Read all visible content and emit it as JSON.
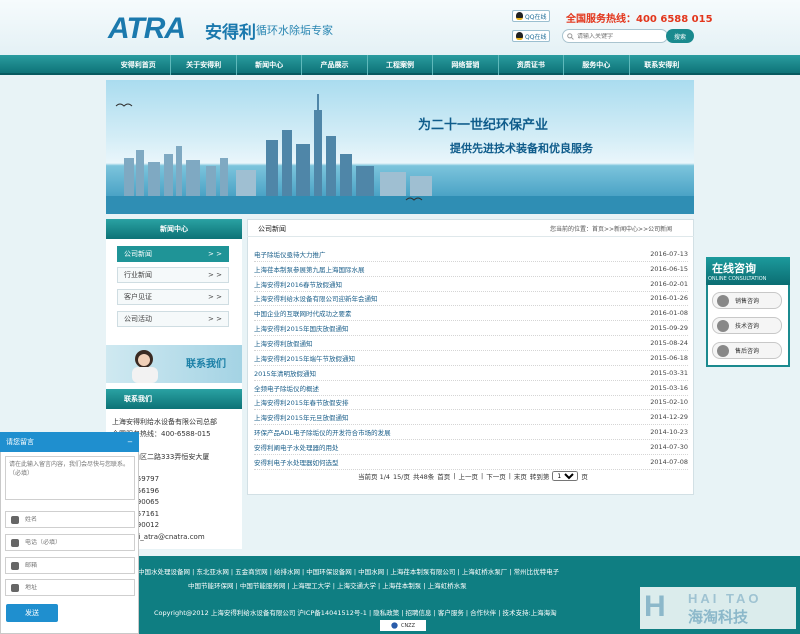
{
  "header": {
    "logo_text": "ATRA",
    "brand_cn": "安得利",
    "slogan": "循环水除垢专家",
    "qq_label_1": "QQ在线",
    "qq_label_2": "QQ在线",
    "hotline": "全国服务热线：400 6588 015",
    "search_placeholder": "请输入关键字",
    "search_button": "搜索"
  },
  "nav": [
    "安得利首页",
    "关于安得利",
    "新闻中心",
    "产品展示",
    "工程案例",
    "网络营销",
    "资质证书",
    "服务中心",
    "联系安得利"
  ],
  "banner": {
    "title": "为二十一世纪环保产业",
    "subtitle": "提供先进技术装备和优良服务"
  },
  "sidebar": {
    "title": "新闻中心",
    "arrow": "> >",
    "items": [
      {
        "label": "公司新闻",
        "active": true
      },
      {
        "label": "行业新闻",
        "active": false
      },
      {
        "label": "客户见证",
        "active": false
      },
      {
        "label": "公司活动",
        "active": false
      }
    ],
    "contact_image_text": "联系我们",
    "contact_title": "联系我们",
    "contact_lines": [
      "上海安得利给水设备有限公司总部",
      "全国服务热线：400-6588-015",
      "00041",
      "海市宝山区二路333弄恒安大厦",
      "21-62559797",
      "21-62156196",
      "21-69590065",
      "21-62557161",
      "21-69590012",
      "nanghai_atra@cnatra.com"
    ]
  },
  "main": {
    "title": "公司新闻",
    "breadcrumb": "您当前的位置：首页>>新闻中心>>公司新闻",
    "news": [
      {
        "title": "电子除垢仪亟待大力推广",
        "date": "2016-07-13"
      },
      {
        "title": "上海荏本制泵参展第九届上海国际水展",
        "date": "2016-06-15"
      },
      {
        "title": "上海安得利2016春节放假通知",
        "date": "2016-02-01"
      },
      {
        "title": "上海安得利给水设备有限公司迎新年会通知",
        "date": "2016-01-26"
      },
      {
        "title": "中国企业的互联网时代成功之要素",
        "date": "2016-01-08"
      },
      {
        "title": "上海安得利2015年国庆放假通知",
        "date": "2015-09-29"
      },
      {
        "title": "上海安得利放假通知",
        "date": "2015-08-24"
      },
      {
        "title": "上海安得利2015年端午节放假通知",
        "date": "2015-06-18"
      },
      {
        "title": "2015年清明放假通知",
        "date": "2015-03-31"
      },
      {
        "title": "全频电子除垢仪的概述",
        "date": "2015-03-16"
      },
      {
        "title": "上海安得利2015年春节放假安排",
        "date": "2015-02-10"
      },
      {
        "title": "上海安得利2015年元旦放假通知",
        "date": "2014-12-29"
      },
      {
        "title": "环保产品ADL电子除垢仪的开发符合市场的发展",
        "date": "2014-10-23"
      },
      {
        "title": "安得利阐电子水处理器的用处",
        "date": "2014-07-30"
      },
      {
        "title": "安得利电子水处理器如何选型",
        "date": "2014-07-08"
      }
    ],
    "pager": {
      "current": "当前页 1/4",
      "per_page": "15/页",
      "total": "共48条",
      "first": "首页",
      "prev": "上一页",
      "next": "下一页",
      "last": "末页",
      "goto": "转到第",
      "goto_value": "1",
      "page_suffix": "页"
    }
  },
  "online": {
    "title": "在线咨询",
    "subtitle": "ONLINE CONSULTATION",
    "buttons": [
      "销售咨询",
      "技术咨询",
      "售后咨询"
    ]
  },
  "footer": {
    "links_row1": "中国水处理设备网 | 东北亚水网 | 五金商贸网 | 给排水网 | 中国环保设备网 | 中国水网 | 上海荏本制泵有限公司 | 上海虹桥水泵厂 | 常州比优特电子",
    "links_row2": "中国节能环保网 | 中国节能服务网 | 上海理工大学 | 上海交通大学 | 上海荏本制泵 | 上海虹桥水泵",
    "copyright": "Copyright@2012 上海安得利给水设备有限公司 沪ICP备14041512号-1 | 隐私政策 | 招聘信息 | 客户服务 | 合作伙伴 | 技术支持:上海海淘",
    "badge": "CNZZ",
    "watermark_en": "HAI TAO",
    "watermark_cn": "海淘科技"
  },
  "message": {
    "title": "请您留言",
    "close": "−",
    "textarea_placeholder": "请在此输入留言内容，我们会尽快与您联系。（必填）",
    "name_placeholder": "姓名",
    "phone_placeholder": "电话（必填）",
    "email_placeholder": "邮箱",
    "address_placeholder": "地址",
    "send": "发送"
  }
}
